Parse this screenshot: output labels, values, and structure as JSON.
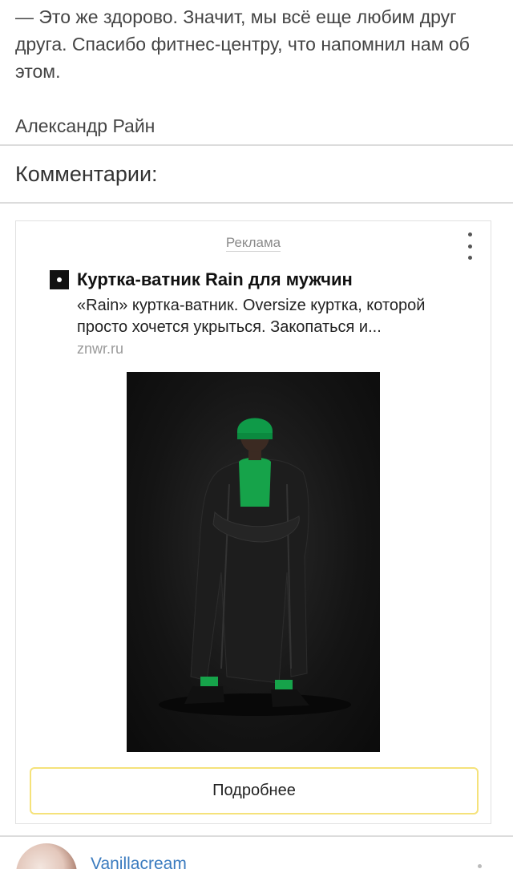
{
  "article": {
    "text": "— Это же здорово. Значит, мы всё еще любим друг друга. Спасибо фитнес-центру, что напомнил нам об этом.",
    "author": "Александр Райн"
  },
  "comments_section": {
    "title": "Комментарии:"
  },
  "ad": {
    "label": "Реклама",
    "title": "Куртка-ватник Rain для мужчин",
    "description": "«Rain» куртка-ватник. Oversize куртка, которой просто хочется укрыться. Закопаться и...",
    "domain": "znwr.ru",
    "button_label": "Подробнее",
    "image_subject": "man in black oversized long coat with green beanie and green sweater",
    "accent_color": "#f5e27a"
  },
  "comment_preview": {
    "author": "Vanillacream"
  },
  "icons": {
    "more": "more-vertical-icon",
    "favicon": "site-favicon-icon"
  }
}
